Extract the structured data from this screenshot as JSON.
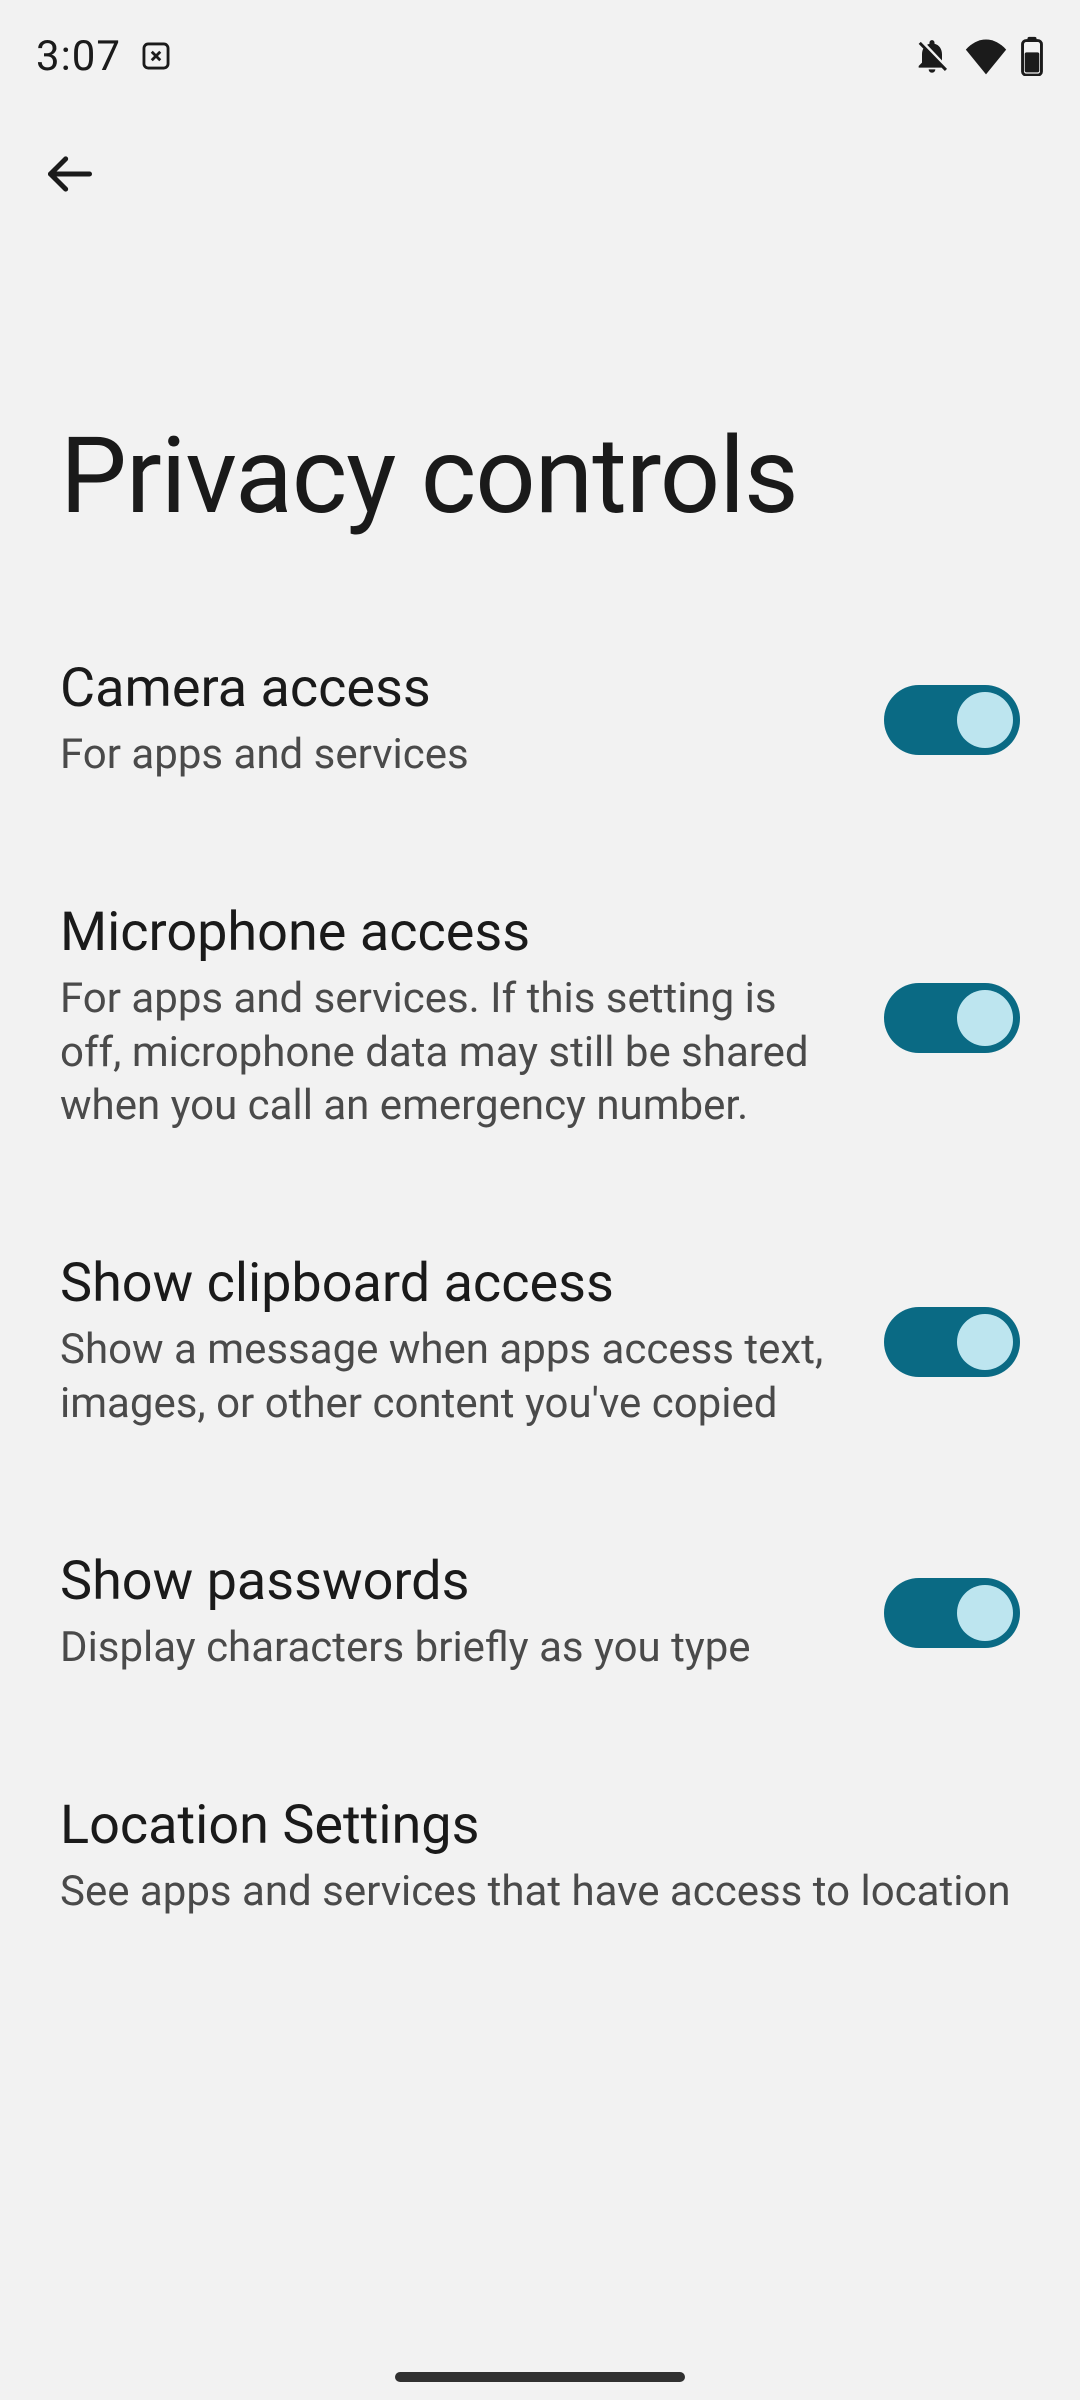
{
  "status": {
    "time": "3:07"
  },
  "header": {
    "title": "Privacy controls"
  },
  "settings": [
    {
      "id": "camera-access",
      "title": "Camera access",
      "subtitle": "For apps and services",
      "toggle": true
    },
    {
      "id": "microphone-access",
      "title": "Microphone access",
      "subtitle": "For apps and services. If this setting is off, microphone data may still be shared when you call an emergency number.",
      "toggle": true
    },
    {
      "id": "show-clipboard-access",
      "title": "Show clipboard access",
      "subtitle": "Show a message when apps access text, images, or other content you've copied",
      "toggle": true
    },
    {
      "id": "show-passwords",
      "title": "Show passwords",
      "subtitle": "Display characters briefly as you type",
      "toggle": true
    },
    {
      "id": "location-settings",
      "title": "Location Settings",
      "subtitle": "See apps and services that have access to location",
      "toggle": null
    }
  ]
}
